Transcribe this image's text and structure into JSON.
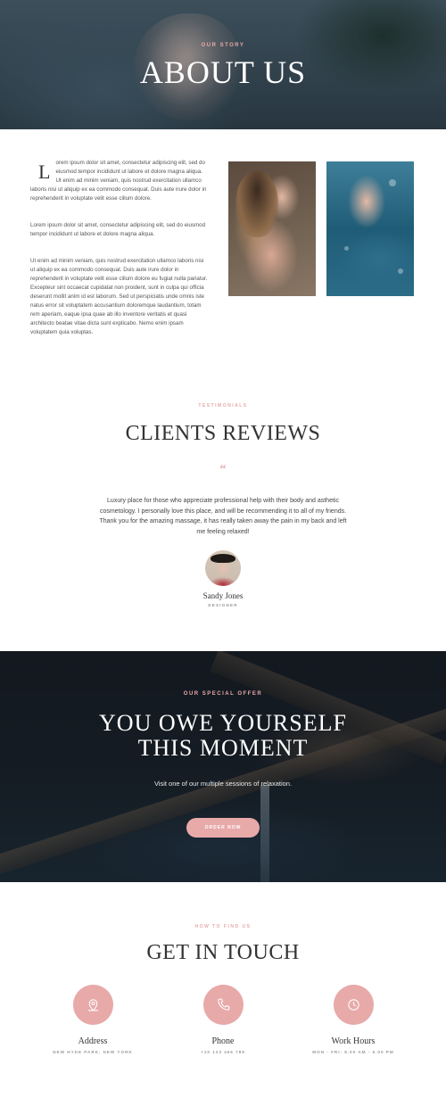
{
  "hero": {
    "eyebrow": "OUR STORY",
    "title": "ABOUT US"
  },
  "story": {
    "dropcap": "L",
    "paragraphs": [
      "orem ipsum dolor sit amet, consectetur adipiscing elit, sed do eiusmod tempor incididunt ut labore et dolore magna aliqua. Ut enim ad minim veniam, quis nostrud exercitation ullamco laboris nisi ut aliquip ex ea commodo consequat. Duis aute irure dolor in reprehenderit in voluptate velit esse cillum dolore.",
      "Lorem ipsum dolor sit amet, consectetur adipiscing elit, sed do eiusmod tempor incididunt ut labore et dolore magna aliqua.",
      "Ut enim ad minim veniam, quis nostrud exercitation ullamco laboris nisi ut aliquip ex ea commodo consequat. Duis aute irure dolor in reprehenderit in voluptate velit esse cillum dolore eu fugiat nulla pariatur. Excepteur sint occaecat cupidatat non proident, sunt in culpa qui officia deserunt mollit anim id est laborum. Sed ut perspiciatis unde omnis iste natus error sit voluptatem accusantium doloremque laudantium, totam rem aperiam, eaque ipsa quae ab illo inventore veritatis et quasi architecto beatae vitae dicta sunt explicabo. Nemo enim ipsam voluptatem quia voluptas."
    ]
  },
  "testimonials": {
    "eyebrow": "TESTIMONIALS",
    "title": "CLIENTS REVIEWS",
    "quote_mark": "“",
    "review": "Luxury place for those who appreciate professional help with their body and asthetic cosmetology. I personally love this place, and will be recommending it to all of my friends. Thank you for the amazing massage, it has really taken away the pain in my back and left me feeling relaxed!",
    "name": "Sandy Jones",
    "role": "DESIGNER"
  },
  "offer": {
    "eyebrow": "OUR SPECIAL OFFER",
    "title_line1": "YOU OWE YOURSELF",
    "title_line2": "THIS MOMENT",
    "text": "Visit one of our multiple sessions of relaxation.",
    "button": "ORDER NOW"
  },
  "contact": {
    "eyebrow": "HOW TO FIND US",
    "title": "GET IN TOUCH",
    "items": [
      {
        "icon": "location-pin-icon",
        "label": "Address",
        "value": "NEW HYDE PARK, NEW YORK"
      },
      {
        "icon": "phone-icon",
        "label": "Phone",
        "value": "+10 123 456 789"
      },
      {
        "icon": "clock-icon",
        "label": "Work Hours",
        "value": "MON - FRI: 8.00 AM - 6.00 PM"
      }
    ]
  },
  "colors": {
    "accent": "#e8a9a9",
    "heading": "#333333",
    "dark_section": "#1c232b"
  }
}
